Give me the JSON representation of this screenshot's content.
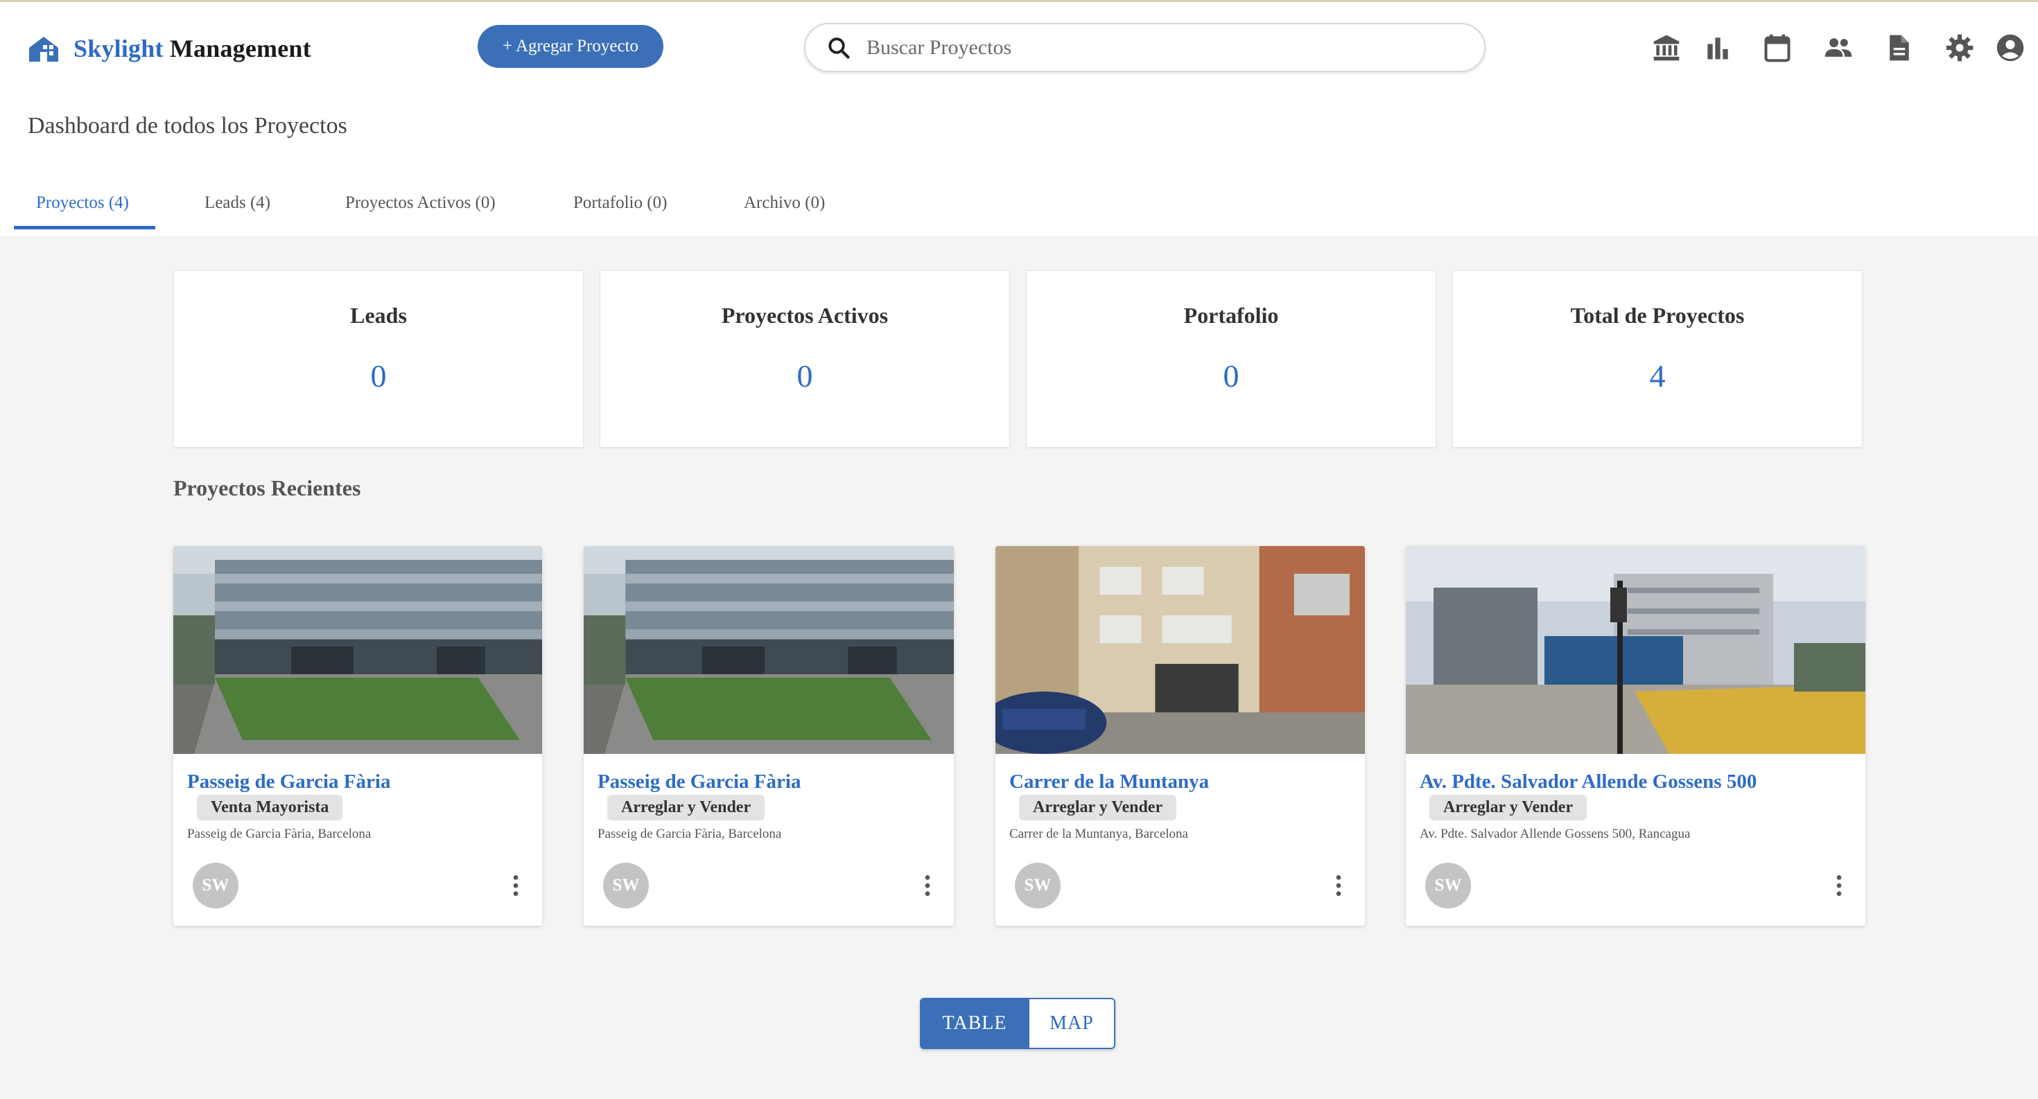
{
  "header": {
    "brand_first": "Skylight",
    "brand_second": " Management",
    "add_project_label": "+ Agregar Proyecto",
    "search_placeholder": "Buscar Proyectos",
    "nav_icons": [
      "bank-icon",
      "bar-chart-icon",
      "calendar-icon",
      "people-icon",
      "document-icon",
      "gear-icon",
      "account-icon"
    ]
  },
  "page": {
    "title": "Dashboard de todos los Proyectos"
  },
  "tabs": [
    {
      "label": "Proyectos (4)",
      "active": true
    },
    {
      "label": "Leads (4)",
      "active": false
    },
    {
      "label": "Proyectos Activos (0)",
      "active": false
    },
    {
      "label": "Portafolio (0)",
      "active": false
    },
    {
      "label": "Archivo (0)",
      "active": false
    }
  ],
  "stats": [
    {
      "label": "Leads",
      "value": "0"
    },
    {
      "label": "Proyectos Activos",
      "value": "0"
    },
    {
      "label": "Portafolio",
      "value": "0"
    },
    {
      "label": "Total de Proyectos",
      "value": "4"
    }
  ],
  "recent": {
    "title": "Proyectos Recientes",
    "projects": [
      {
        "title": "Passeig de Garcia Fària",
        "tag": "Venta Mayorista",
        "address": "Passeig de Garcia Fària, Barcelona",
        "avatar": "SW"
      },
      {
        "title": "Passeig de Garcia Fària",
        "tag": "Arreglar y Vender",
        "address": "Passeig de Garcia Fària, Barcelona",
        "avatar": "SW"
      },
      {
        "title": "Carrer de la Muntanya",
        "tag": "Arreglar y Vender",
        "address": "Carrer de la Muntanya, Barcelona",
        "avatar": "SW"
      },
      {
        "title": "Av. Pdte. Salvador Allende Gossens 500",
        "tag": "Arreglar y Vender",
        "address": "Av. Pdte. Salvador Allende Gossens 500, Rancagua",
        "avatar": "SW"
      }
    ]
  },
  "view_toggle": {
    "table_label": "TABLE",
    "map_label": "MAP"
  },
  "colors": {
    "accent": "#2e6bc6",
    "button": "#3b6fb8",
    "background": "#f4f4f4"
  }
}
